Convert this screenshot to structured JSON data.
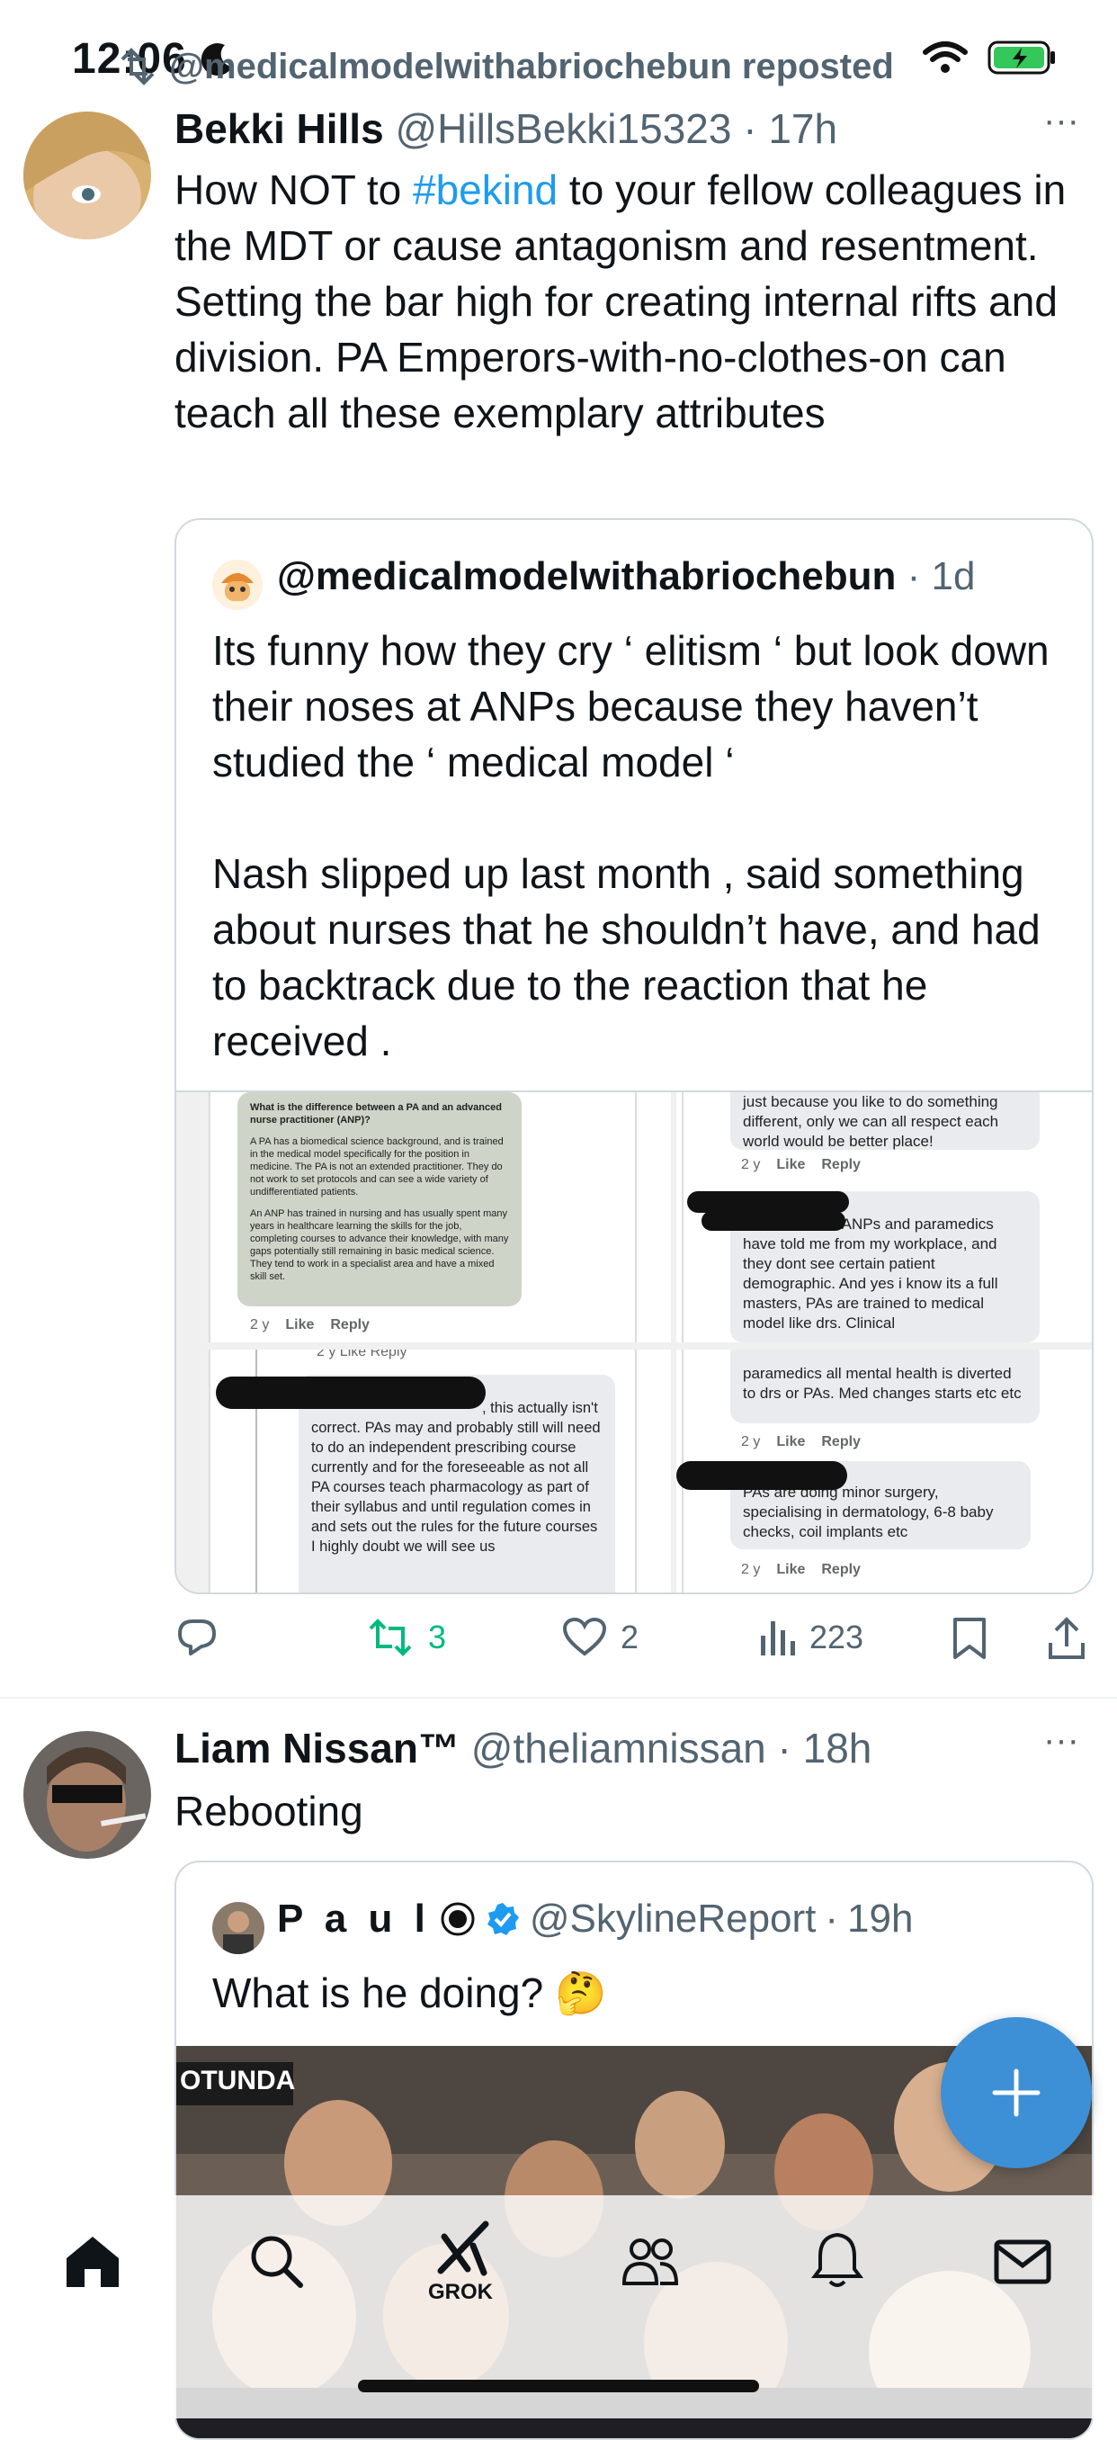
{
  "status_bar": {
    "time": "12:06"
  },
  "repost_header": {
    "text": "@medicalmodelwithabriochebun reposted"
  },
  "tweet1": {
    "display_name": "Bekki Hills",
    "handle": "@HillsBekki15323",
    "separator": "·",
    "time": "17h",
    "more": "···",
    "text_pre": "How NOT to ",
    "hashtag": "#bekind",
    "text_post": " to your fellow colleagues in the MDT or cause antagonism and resentment. Setting the bar high for creating internal rifts and division. PA Emperors-with-no-clothes-on can teach all these exemplary attributes",
    "quote": {
      "handle": "@medicalmodelwithabriochebun",
      "separator": "·",
      "time": "1d",
      "text": "Its funny how they cry ‘ elitism ‘ but look down their noses at ANPs because they haven’t studied the ‘ medical model ‘\n\nNash slipped up last month , said something about nurses that he shouldn’t have, and had to backtrack due to the reaction that he received .",
      "media": {
        "c1_title": "What is the difference between a PA and an advanced nurse practitioner (ANP)?",
        "c1_p1": "A PA has a biomedical science background, and is trained in the medical model specifically for the position in medicine. The PA is not an extended practitioner. They do not work to set protocols and can see a wide variety of undifferentiated patients.",
        "c1_p2": "An ANP has trained in nursing and has usually spent many years in healthcare learning the skills for the job, completing courses to advance their knowledge, with many gaps potentially still remaining in basic medical science. They tend to work in a specialist area and have a mixed skill set.",
        "c1_meta": "2 y",
        "c2_text": "just because you like to do something different, only we can all respect each world would be better place!",
        "c2_meta": "2 y",
        "c2b_text": "thats what the ANPs and paramedics have told me from my workplace, and they dont see certain patient demographic. And yes i know its a full masters,  PAs are trained to medical model like drs. Clinical",
        "c3_meta_top": "2 y   Like   Reply",
        "c3_text": ", this actually isn't correct. PAs may and probably still will need to do an independent prescribing course currently and for the foreseeable as not all PA courses teach pharmacology as part of their syllabus and until regulation comes in and sets out the rules for the future courses I highly doubt we will see us",
        "c4_text": "paramedics all mental health is diverted to drs or PAs. Med changes starts etc etc",
        "c4_meta": "2 y",
        "c4b_text": "PAs are doing minor surgery, specialising in dermatology, 6-8 baby checks, coil implants etc",
        "c4b_meta": "2 y",
        "like": "Like",
        "reply": "Reply"
      }
    },
    "actions": {
      "retweets": "3",
      "likes": "2",
      "views": "223"
    }
  },
  "tweet2": {
    "display_name": "Liam Nissan™",
    "handle": "@theliamnissan",
    "separator": "·",
    "time": "18h",
    "more": "···",
    "text": "Rebooting",
    "quote": {
      "display_name": "P a u l",
      "handle": "@SkylineReport",
      "separator": "·",
      "time": "19h",
      "text": "What is he doing? 🤔",
      "video_overlay": "OTUNDA"
    }
  },
  "nav": {
    "grok_label": "GROK"
  },
  "colors": {
    "accent": "#1d9bf0",
    "retweet_green": "#00ba7c",
    "muted": "#536471",
    "fab": "#3d8fd6"
  }
}
